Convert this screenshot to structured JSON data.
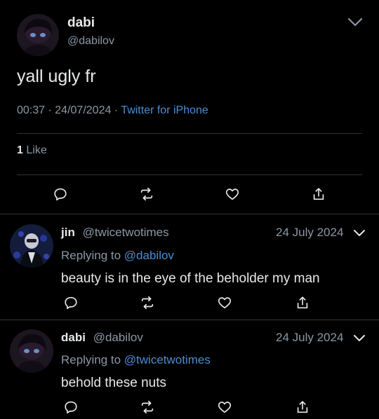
{
  "main_tweet": {
    "display_name": "dabi",
    "handle": "@dabilov",
    "text": "yall ugly fr",
    "time": "00:37",
    "date": "24/07/2024",
    "source": "Twitter for iPhone",
    "likes_count": "1",
    "likes_label": "Like"
  },
  "replies": [
    {
      "display_name": "jin",
      "handle": "@twicetwotimes",
      "date": "24 July 2024",
      "replying_label": "Replying to",
      "replying_to": "@dabilov",
      "text": "beauty is in the eye of the beholder my man"
    },
    {
      "display_name": "dabi",
      "handle": "@dabilov",
      "date": "24 July 2024",
      "replying_label": "Replying to",
      "replying_to": "@twicetwotimes",
      "text": "behold these nuts"
    }
  ],
  "colors": {
    "background": "#000000",
    "text": "#e7e9ea",
    "muted": "#8b98a5",
    "link": "#4b8ed1"
  },
  "icons": [
    "reply-icon",
    "retweet-icon",
    "like-icon",
    "share-icon",
    "chevron-down-icon"
  ]
}
